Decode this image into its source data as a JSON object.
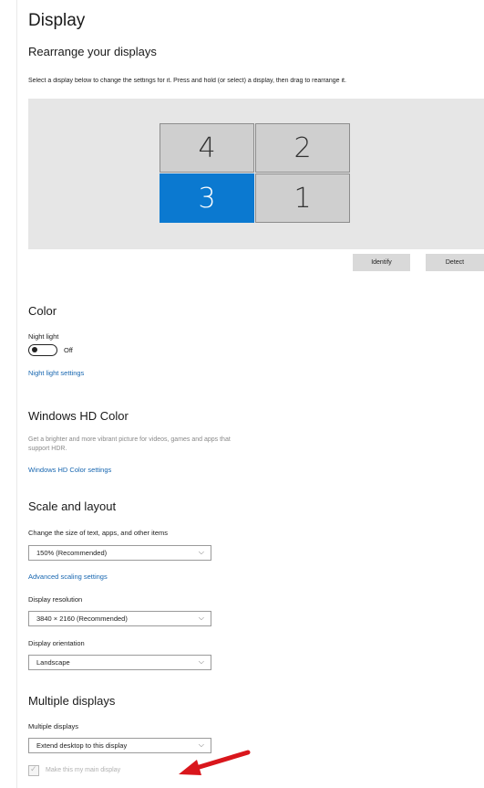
{
  "header": {
    "title": "Display",
    "subtitle": "Rearrange your displays",
    "instruction": "Select a display below to change the settings for it. Press and hold (or select) a display, then drag to rearrange it."
  },
  "arrangement": {
    "displays": [
      {
        "label": "4",
        "selected": false
      },
      {
        "label": "2",
        "selected": false
      },
      {
        "label": "3",
        "selected": true
      },
      {
        "label": "1",
        "selected": false
      }
    ],
    "identify_label": "Identify",
    "detect_label": "Detect",
    "selected_color": "#0b79d0"
  },
  "color": {
    "heading": "Color",
    "night_light_label": "Night light",
    "night_light_state": "Off",
    "night_light_link": "Night light settings"
  },
  "hd_color": {
    "heading": "Windows HD Color",
    "description_line1": "Get a brighter and more vibrant picture for videos, games and apps that",
    "description_line2": "support HDR.",
    "link": "Windows HD Color settings"
  },
  "scale": {
    "heading": "Scale and layout",
    "size_label": "Change the size of text, apps, and other items",
    "size_value": "150% (Recommended)",
    "advanced_link": "Advanced scaling settings",
    "resolution_label": "Display resolution",
    "resolution_value": "3840 × 2160 (Recommended)",
    "orientation_label": "Display orientation",
    "orientation_value": "Landscape"
  },
  "multiple": {
    "heading": "Multiple displays",
    "label": "Multiple displays",
    "value": "Extend desktop to this display",
    "main_display_label": "Make this my main display",
    "main_display_checked": true,
    "arrow_color": "#d9161c"
  }
}
